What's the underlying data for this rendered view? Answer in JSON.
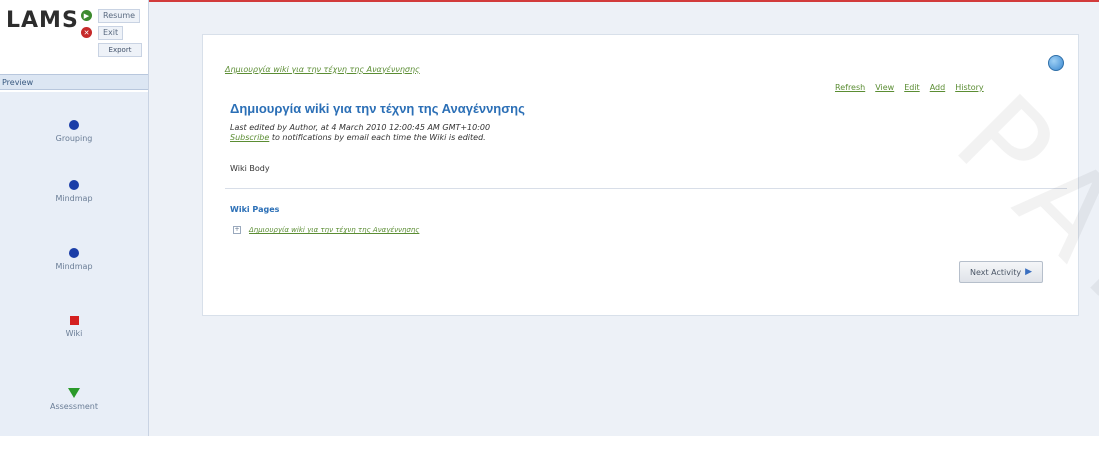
{
  "brand": {
    "logo": "LAMS"
  },
  "controls": {
    "resume_label": "Resume",
    "exit_label": "Exit",
    "export_label": "Export"
  },
  "preview": {
    "label": "Preview"
  },
  "activities": [
    {
      "label": "Grouping",
      "marker": "circle"
    },
    {
      "label": "Mindmap",
      "marker": "circle"
    },
    {
      "label": "Mindmap",
      "marker": "circle"
    },
    {
      "label": "Wiki",
      "marker": "square"
    },
    {
      "label": "Assessment",
      "marker": "triangle"
    }
  ],
  "wiki": {
    "breadcrumb": "Δημιουργία wiki για την τέχνη της Αναγέννησης",
    "toolbar": [
      "Refresh",
      "View",
      "Edit",
      "Add",
      "History"
    ],
    "title": "Δημιουργία wiki για την τέχνη της Αναγέννησης",
    "meta": "Last edited by Author, at 4 March 2010 12:00:45 AM GMT+10:00",
    "subscribe_link": "Subscribe",
    "subscribe_rest": " to notifications by email each time the Wiki is edited.",
    "body": "Wiki Body",
    "pages_header": "Wiki Pages",
    "pages": [
      "Δημιουργία wiki για την τέχνη της Αναγέννησης"
    ],
    "next_button": "Next Activity"
  },
  "watermark": "PANA"
}
